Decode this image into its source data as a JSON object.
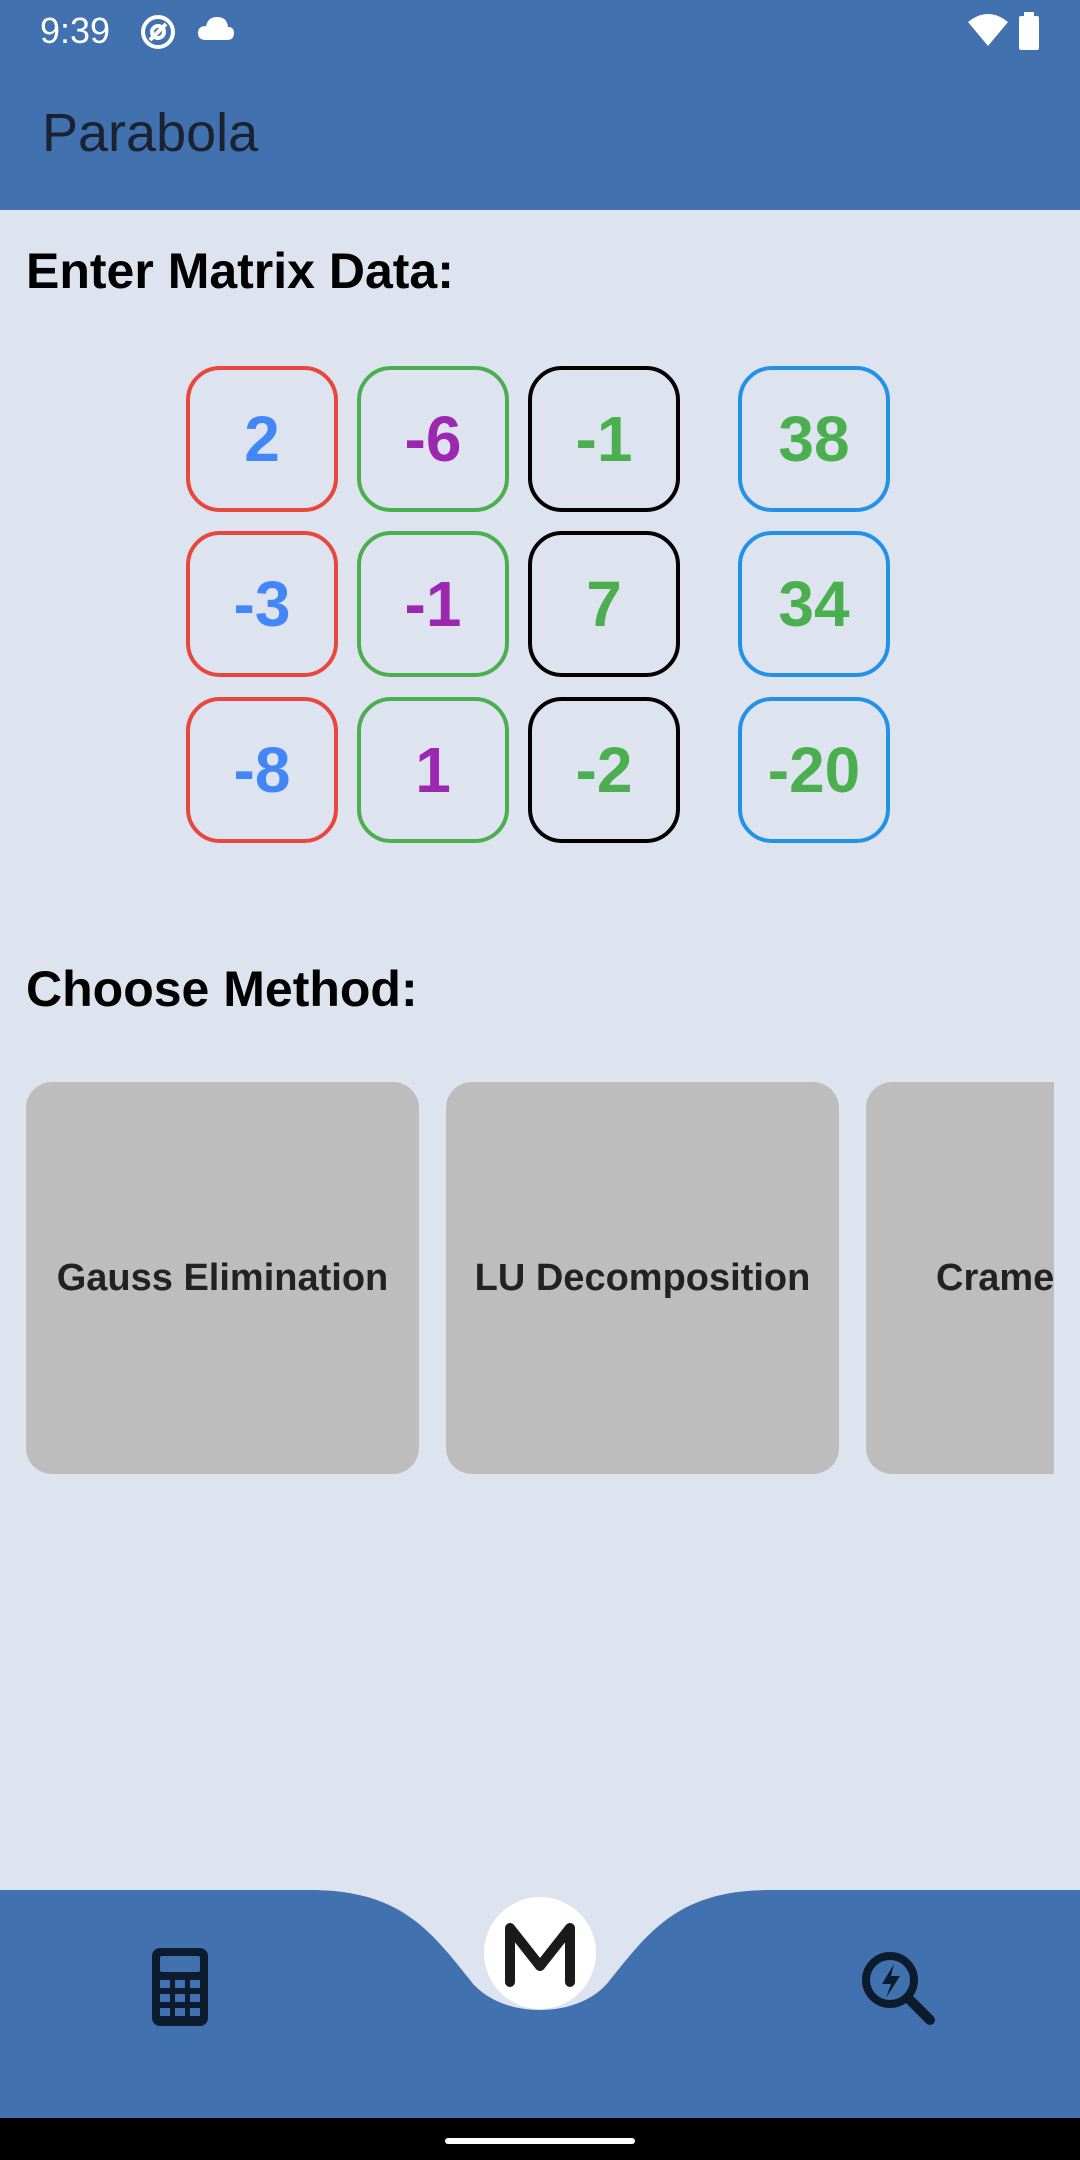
{
  "status_bar": {
    "time": "9:39",
    "icons": [
      "at-sign-icon",
      "cloud-icon",
      "wifi-icon",
      "battery-icon"
    ]
  },
  "app_bar": {
    "title": "Parabola"
  },
  "matrix_section": {
    "heading": "Enter Matrix Data:",
    "rows": [
      [
        "2",
        "-6",
        "-1",
        "38"
      ],
      [
        "-3",
        "-1",
        "7",
        "34"
      ],
      [
        "-8",
        "1",
        "-2",
        "-20"
      ]
    ]
  },
  "method_section": {
    "heading": "Choose Method:",
    "methods": [
      "Gauss Elimination",
      "LU Decomposition",
      "Crame"
    ]
  },
  "bottom_nav": {
    "left_icon": "calculator-icon",
    "center_icon": "m-logo-icon",
    "right_icon": "search-bolt-icon"
  },
  "colors": {
    "app_bar": "#4171ae",
    "background": "#dee3f0",
    "col1_border": "#e8473d",
    "col2_border": "#4bae4f",
    "col3_border": "#000000",
    "rhs_border": "#2392e6",
    "blue_text": "#4287f5",
    "purple_text": "#9c27b0",
    "green_text": "#4bae4f",
    "card_bg": "#bdbdbd"
  }
}
